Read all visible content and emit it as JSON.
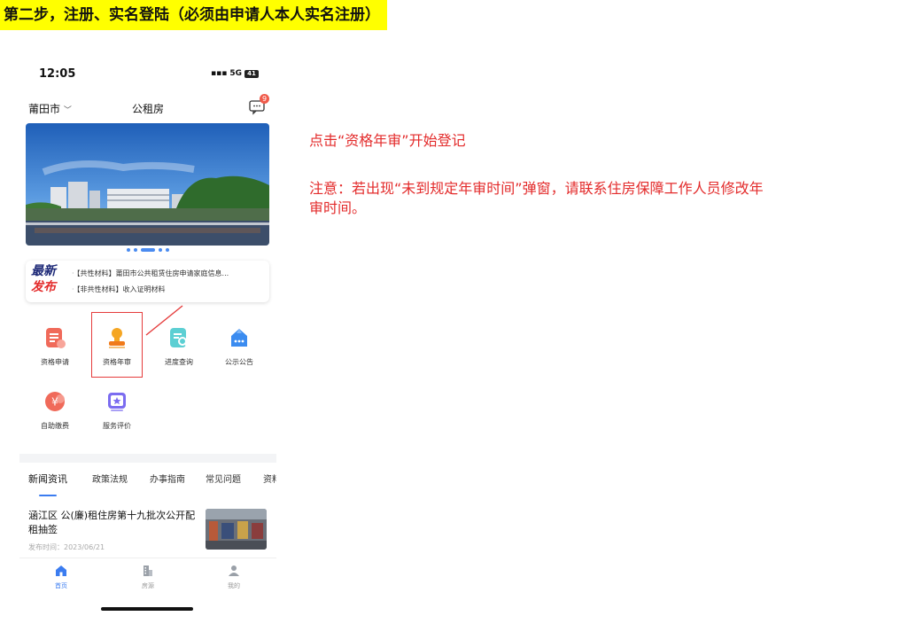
{
  "heading": "第二步，注册、实名登陆（必须由申请人本人实名注册）",
  "phone": {
    "status_bar": {
      "time": "12:05",
      "network": "5G",
      "battery": "41"
    },
    "top_bar": {
      "city": "莆田市",
      "title": "公租房",
      "message_badge": "9"
    },
    "banner_dots": 5,
    "latest_news": {
      "badge_line1": "最新",
      "badge_line2": "发布",
      "items": [
        "【共性材料】莆田市公共租赁住房申请家庭信息...",
        "【非共性材料】收入证明材料"
      ]
    },
    "services": [
      {
        "label": "资格申请",
        "icon": "application-form-icon",
        "color": "#f06a5a"
      },
      {
        "label": "资格年审",
        "icon": "annual-review-stamp-icon",
        "color": "#f5a623"
      },
      {
        "label": "进度查询",
        "icon": "progress-search-icon",
        "color": "#4fc3c8"
      },
      {
        "label": "公示公告",
        "icon": "notice-bag-icon",
        "color": "#3b8cf0"
      },
      {
        "label": "自助缴费",
        "icon": "payment-yuan-icon",
        "color": "#f06a5a"
      },
      {
        "label": "服务评价",
        "icon": "rating-star-icon",
        "color": "#7b6cf0"
      }
    ],
    "tabs": [
      "新闻资讯",
      "政策法规",
      "办事指南",
      "常见问题",
      "资料"
    ],
    "article": {
      "title": "涵江区 公(廉)租住房第十九批次公开配租抽签",
      "time": "发布时间：2023/06/21"
    },
    "bottom_nav": [
      {
        "label": "首页",
        "icon": "home-icon",
        "active": true
      },
      {
        "label": "房源",
        "icon": "building-icon",
        "active": false
      },
      {
        "label": "我的",
        "icon": "user-icon",
        "active": false
      }
    ]
  },
  "instruction": "点击“资格年审”开始登记",
  "note_line1": "注意：若出现“未到规定年审时间”弹窗，请联系住房保障工作人员修改年",
  "note_line2": "审时间。",
  "colors": {
    "highlight": "#e32b2b",
    "heading_bg": "#ffff00",
    "accent_blue": "#3b7cf0"
  }
}
